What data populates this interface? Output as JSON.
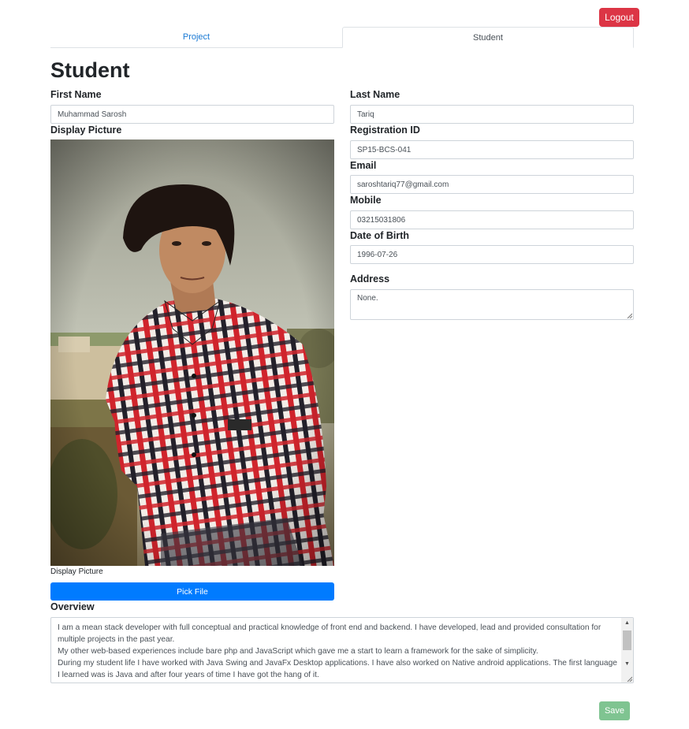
{
  "header": {
    "logout_label": "Logout"
  },
  "tabs": [
    {
      "label": "Project"
    },
    {
      "label": "Student"
    }
  ],
  "page": {
    "title": "Student"
  },
  "form": {
    "first_name": {
      "label": "First Name",
      "value": "Muhammad Sarosh"
    },
    "last_name": {
      "label": "Last Name",
      "value": "Tariq"
    },
    "registration_id": {
      "label": "Registration ID",
      "value": "SP15-BCS-041"
    },
    "email": {
      "label": "Email",
      "value": "saroshtariq77@gmail.com"
    },
    "mobile": {
      "label": "Mobile",
      "value": "03215031806"
    },
    "date_of_birth": {
      "label": "Date of Birth",
      "value": "1996-07-26"
    },
    "address": {
      "label": "Address",
      "value": "None."
    },
    "display_picture": {
      "label": "Display Picture",
      "caption": "Display Picture",
      "pick_label": "Pick File"
    },
    "overview": {
      "label": "Overview",
      "lines": [
        "I am a mean stack developer with full conceptual and practical knowledge of front end and backend. I have developed, lead and provided consultation for multiple projects in the past year.",
        "My other web-based experiences include bare php and JavaScript which gave me a start to learn a framework for the sake of simplicity.",
        "During my student life I have worked with Java Swing and JavaFx Desktop applications. I have also worked on Native android applications. The first language I learned was is Java and after four years of time I have got the hang of it."
      ]
    }
  },
  "footer": {
    "save_label": "Save"
  },
  "icons": {
    "scroll_up": "scroll-up-arrow-icon",
    "scroll_down": "scroll-down-arrow-icon",
    "resize": "resize-grip-icon"
  },
  "colors": {
    "danger": "#dc3545",
    "primary": "#007bff",
    "success_muted": "#7fc491",
    "link": "#1a7ad4"
  }
}
